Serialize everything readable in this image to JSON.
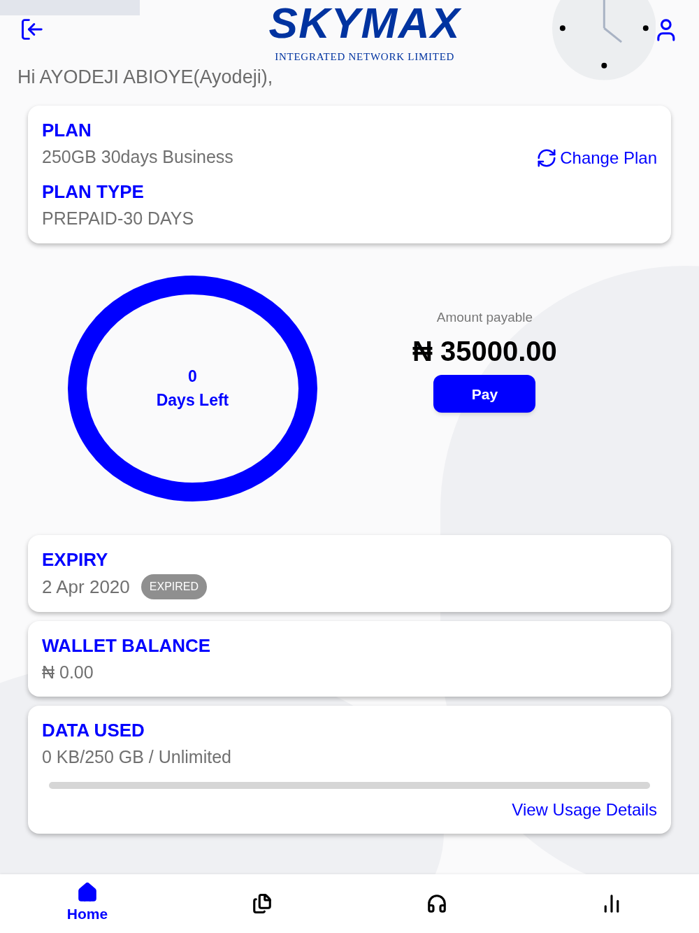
{
  "header": {
    "logo_title": "SKYMAX",
    "logo_subtitle": "INTEGRATED NETWORK LIMITED"
  },
  "greeting": "Hi AYODEJI ABIOYE(Ayodeji),",
  "plan_card": {
    "plan_label": "PLAN",
    "plan_value": "250GB 30days Business",
    "change_plan": "Change Plan",
    "type_label": "PLAN TYPE",
    "type_value": "PREPAID-30 DAYS"
  },
  "days": {
    "count": "0",
    "label": "Days Left"
  },
  "payment": {
    "label": "Amount payable",
    "amount": "₦ 35000.00",
    "button": "Pay"
  },
  "expiry": {
    "label": "EXPIRY",
    "date": "2 Apr 2020",
    "badge": "EXPIRED"
  },
  "wallet": {
    "label": "WALLET BALANCE",
    "value": "₦ 0.00"
  },
  "data_used": {
    "label": "DATA USED",
    "value": "0 KB/250 GB / Unlimited",
    "level": 0,
    "link": "View Usage Details"
  },
  "nav": [
    {
      "kind": "home",
      "label": "Home",
      "selected": true
    },
    {
      "kind": "documents",
      "selected": false
    },
    {
      "kind": "support",
      "selected": false
    },
    {
      "kind": "stats",
      "selected": false
    }
  ]
}
